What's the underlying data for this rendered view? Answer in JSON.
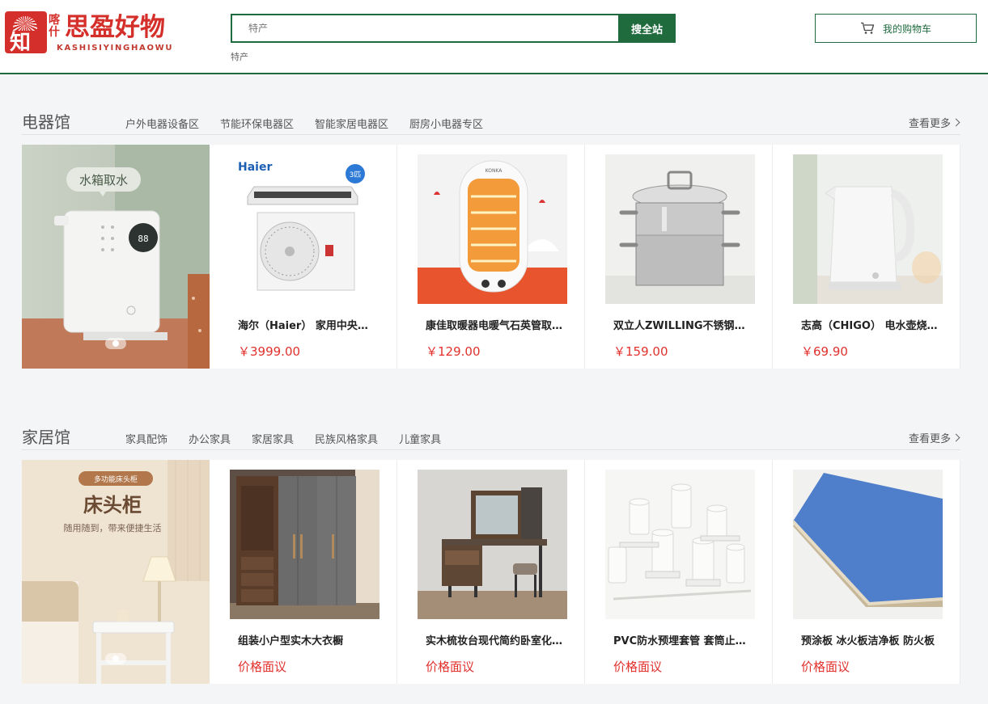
{
  "brand": {
    "logo_small": "喀什",
    "logo_main": "思盈好物",
    "logo_sub": "KASHISIYINGHAOWU"
  },
  "search": {
    "placeholder": "特产",
    "button_label": "搜全站",
    "hot_word": "特产"
  },
  "cart": {
    "label": "我的购物车"
  },
  "sections": [
    {
      "title": "电器馆",
      "tabs": [
        "户外电器设备区",
        "节能环保电器区",
        "智能家居电器区",
        "厨房小电器专区"
      ],
      "more_label": "查看更多",
      "banner_text": "水箱取水",
      "products": [
        {
          "name": "海尔（Haier） 家用中央空调",
          "price": "￥3999.00"
        },
        {
          "name": "康佳取暖器电暖气石英管取暖器",
          "price": "￥129.00"
        },
        {
          "name": "双立人ZWILLING不锈钢蒸锅",
          "price": "￥159.00"
        },
        {
          "name": "志高（CHIGO） 电水壶烧水壶",
          "price": "￥69.90"
        }
      ]
    },
    {
      "title": "家居馆",
      "tabs": [
        "家具配饰",
        "办公家具",
        "家居家具",
        "民族风格家具",
        "儿童家具"
      ],
      "more_label": "查看更多",
      "banner_badge": "多功能床头柜",
      "banner_title": "床头柜",
      "banner_sub": "随用随到，带来便捷生活",
      "products": [
        {
          "name": "组装小户型实木大衣橱",
          "price": "价格面议"
        },
        {
          "name": "实木梳妆台现代简约卧室化妆台",
          "price": "价格面议"
        },
        {
          "name": "PVC防水预埋套管 套筒止水节",
          "price": "价格面议"
        },
        {
          "name": "预涂板 冰火板洁净板 防火板",
          "price": "价格面议"
        }
      ]
    }
  ],
  "product_images": {
    "haier_logo": "Haier",
    "haier_badge": "3匹",
    "heater_brand": "KONKA",
    "water_dispenser_display": "88"
  },
  "colors": {
    "brand_green": "#1f6b3e",
    "brand_red": "#d42f2a",
    "price_red": "#e2312d"
  }
}
